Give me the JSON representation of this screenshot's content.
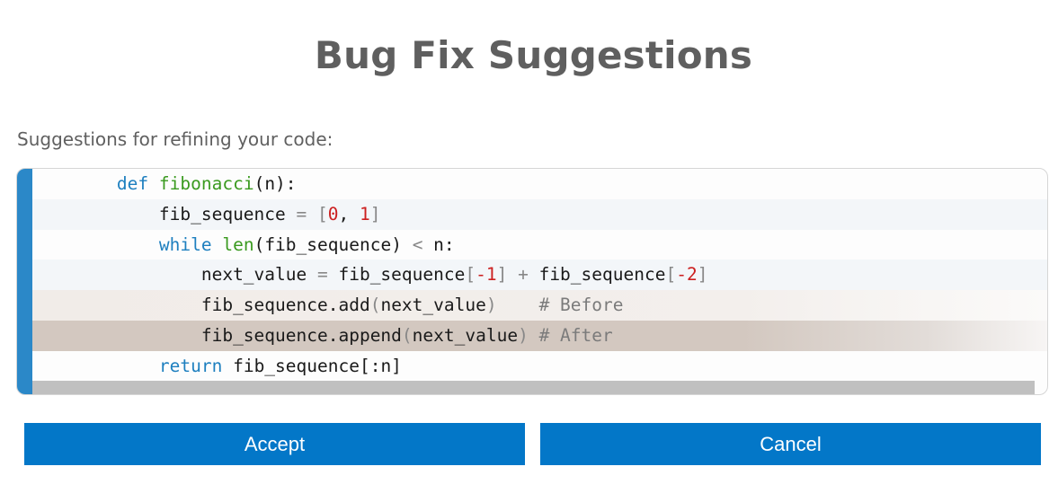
{
  "page": {
    "title": "Bug Fix Suggestions",
    "subtitle": "Suggestions for refining your code:"
  },
  "code": {
    "lines": [
      {
        "indent": "        ",
        "tokens": [
          [
            "kw",
            "def"
          ],
          [
            "",
            ""
          ],
          [
            " ",
            ""
          ]
        ]
      }
    ],
    "line1": {
      "a": "def",
      "b": "fibonacci",
      "c": "(n):"
    },
    "line2": {
      "a": "fib_sequence",
      "b": " = ",
      "c": "[",
      "d": "0",
      "e": ", ",
      "f": "1",
      "g": "]"
    },
    "line3": {
      "a": "while",
      "b": "len",
      "c": "(fib_sequence) ",
      "d": "<",
      "e": " n:"
    },
    "line4": {
      "a": "next_value ",
      "b": "=",
      "c": " fib_sequence",
      "d": "[",
      "e": "-1",
      "f": "]",
      "g": " + ",
      "h": "fib_sequence",
      "i": "[",
      "j": "-2",
      "k": "]"
    },
    "line5": {
      "a": "fib_sequence.",
      "b": "add",
      "c": "(",
      "d": "next_value",
      "e": ")",
      "f": "    # Before"
    },
    "line6": {
      "a": "fib_sequence.",
      "b": "append",
      "c": "(",
      "d": "next_value",
      "e": ")",
      "f": " # After"
    },
    "line7": {
      "a": "return",
      "b": " fib_sequence[:n]"
    }
  },
  "buttons": {
    "accept_label": "Accept",
    "cancel_label": "Cancel"
  },
  "colors": {
    "accent": "#2b88c8",
    "button": "#0377c8",
    "keyword": "#1d7fbf",
    "function": "#3a9a1f",
    "number": "#cc2020",
    "comment": "#7b7b7b"
  }
}
